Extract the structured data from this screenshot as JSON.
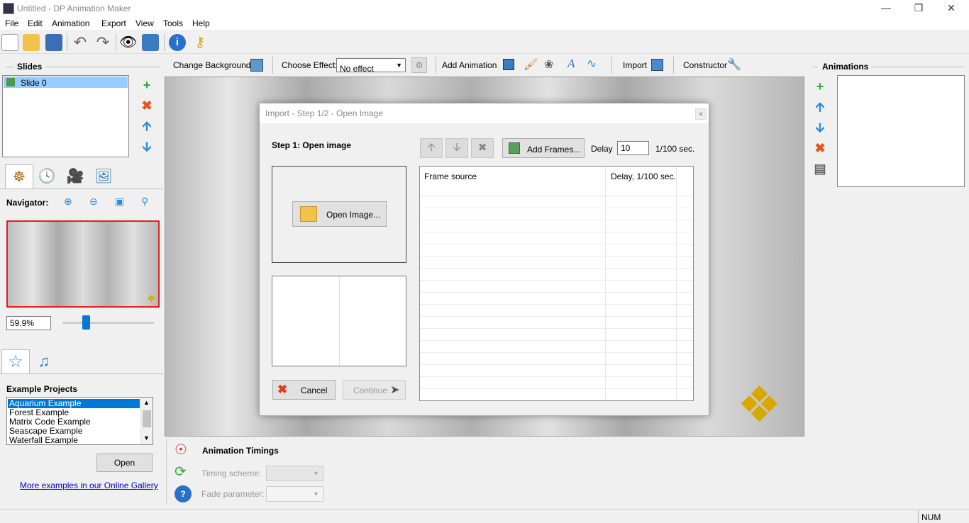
{
  "window": {
    "title": "Untitled - DP Animation Maker"
  },
  "menu": [
    "File",
    "Edit",
    "Animation",
    "Export",
    "View",
    "Tools",
    "Help"
  ],
  "slides": {
    "heading": "Slides",
    "items": [
      "Slide 0"
    ]
  },
  "navigator": {
    "label": "Navigator:",
    "zoom": "59.9%",
    "slider_fraction": 0.23
  },
  "examples": {
    "heading": "Example Projects",
    "items": [
      "Aquarium Example",
      "Forest Example",
      "Matrix Code Example",
      "Seascape Example",
      "Waterfall Example"
    ],
    "open_label": "Open",
    "gallery_link": "More examples in our Online Gallery"
  },
  "effects_bar": {
    "change_background": "Change Background",
    "choose_effect": "Choose Effect:",
    "effect_value": "No effect",
    "add_animation": "Add Animation",
    "import": "Import",
    "constructor": "Constructor"
  },
  "animations": {
    "heading": "Animations"
  },
  "dialog": {
    "title": "Import - Step 1/2 - Open Image",
    "step": "Step 1: Open image",
    "open_image": "Open Image...",
    "add_frames": "Add Frames...",
    "delay_label": "Delay",
    "delay_value": "10",
    "delay_unit": "1/100 sec.",
    "col_source": "Frame source",
    "col_delay": "Delay, 1/100 sec.",
    "cancel": "Cancel",
    "continue": "Continue"
  },
  "timings": {
    "heading": "Animation Timings",
    "timing_scheme": "Timing scheme:",
    "fade_parameter": "Fade parameter:"
  },
  "status": {
    "num": "NUM"
  },
  "colors": {
    "selection": "#99ccff",
    "list_selection": "#0078d7",
    "navigator_border": "#e0201c"
  }
}
